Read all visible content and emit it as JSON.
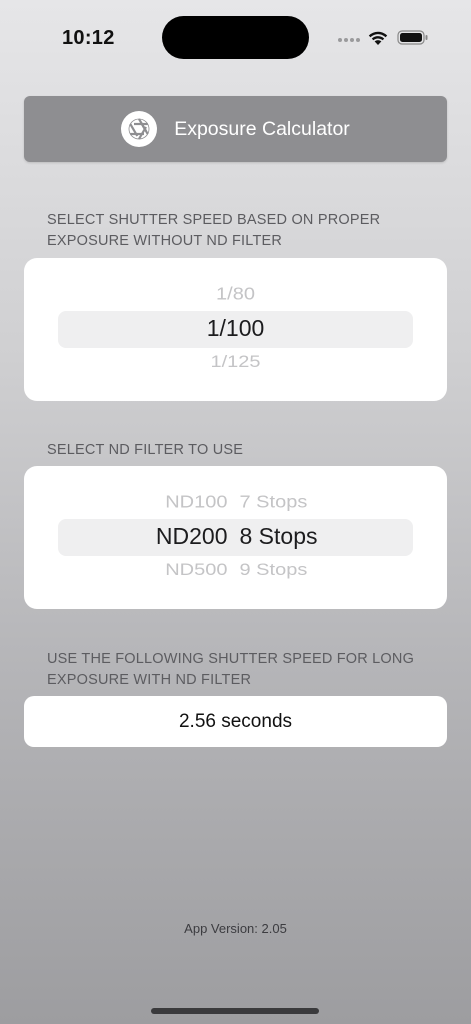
{
  "status_bar": {
    "time": "10:12"
  },
  "header": {
    "title": "Exposure Calculator",
    "icon": "aperture-icon"
  },
  "shutter_section": {
    "label": "SELECT SHUTTER SPEED BASED ON PROPER EXPOSURE WITHOUT ND FILTER",
    "picker": {
      "above": "1/80",
      "selected": "1/100",
      "below": "1/125"
    }
  },
  "nd_section": {
    "label": "SELECT ND FILTER TO USE",
    "picker": {
      "above": {
        "name": "ND100",
        "stops": "7 Stops"
      },
      "selected": {
        "name": "ND200",
        "stops": "8 Stops"
      },
      "below": {
        "name": "ND500",
        "stops": "9 Stops"
      }
    }
  },
  "result_section": {
    "label": "USE THE FOLLOWING SHUTTER SPEED FOR LONG EXPOSURE WITH ND FILTER",
    "value": "2.56 seconds"
  },
  "footer": {
    "app_version": "App Version: 2.05"
  },
  "colors": {
    "header_bg": "#8e8e91",
    "card_bg": "#ffffff",
    "picker_highlight": "#efeff0",
    "label_text": "#5c5c60"
  }
}
